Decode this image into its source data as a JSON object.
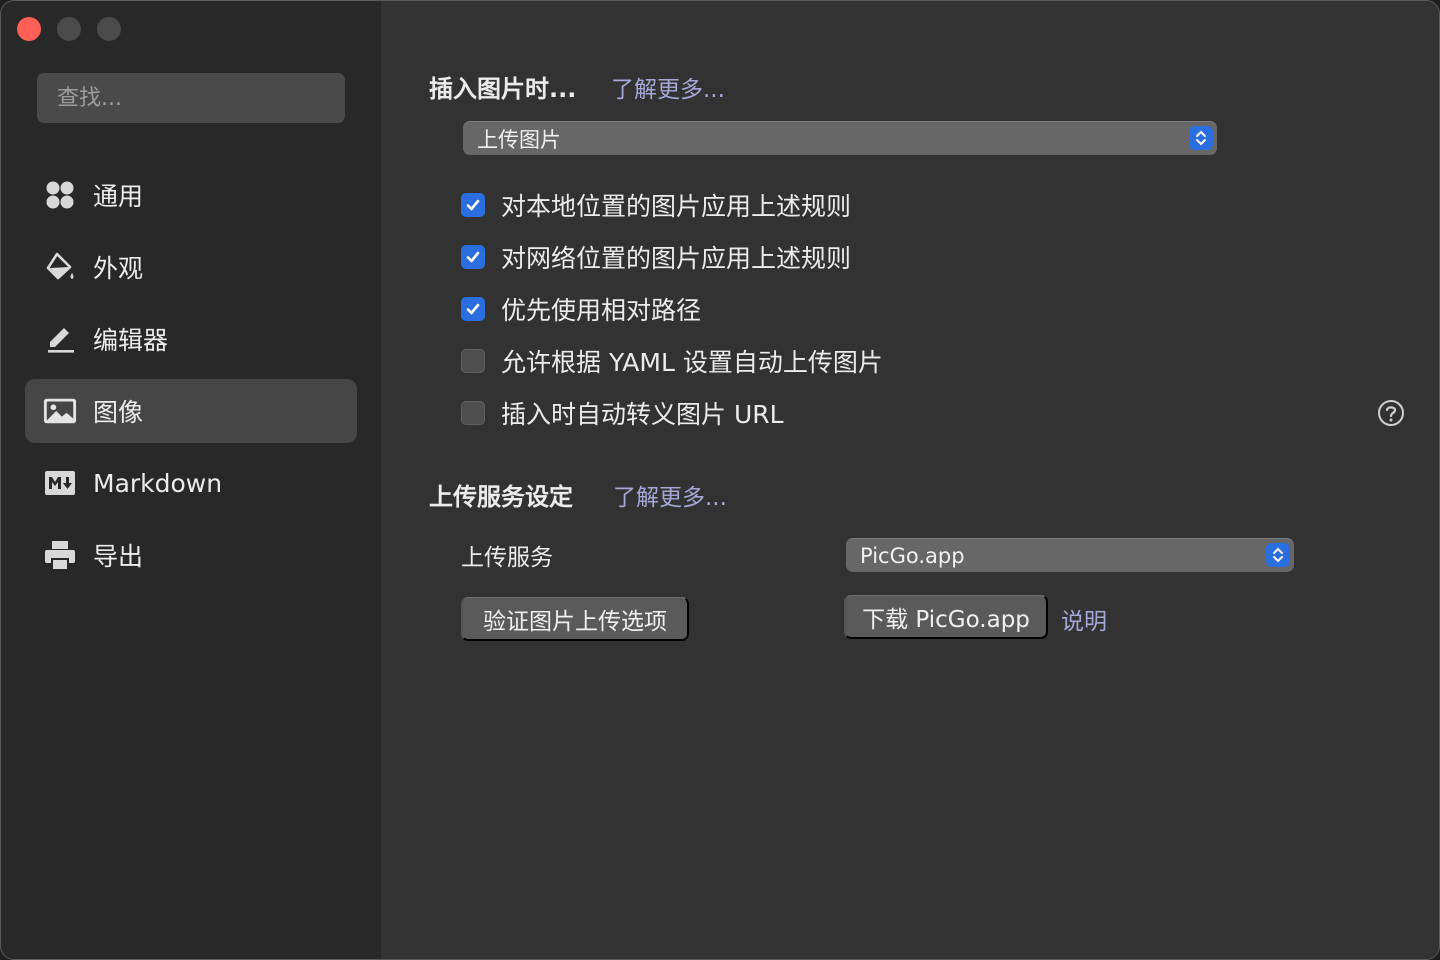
{
  "search": {
    "placeholder": "查找..."
  },
  "sidebar": {
    "items": [
      {
        "label": "通用",
        "icon": "grid-icon",
        "active": false
      },
      {
        "label": "外观",
        "icon": "paint-bucket-icon",
        "active": false
      },
      {
        "label": "编辑器",
        "icon": "pencil-icon",
        "active": false
      },
      {
        "label": "图像",
        "icon": "image-icon",
        "active": true
      },
      {
        "label": "Markdown",
        "icon": "markdown-icon",
        "active": false
      },
      {
        "label": "导出",
        "icon": "printer-icon",
        "active": false
      }
    ]
  },
  "insert_section": {
    "title": "插入图片时...",
    "learn_more": "了解更多...",
    "action_select": "上传图片",
    "options": [
      {
        "label": "对本地位置的图片应用上述规则",
        "checked": true
      },
      {
        "label": "对网络位置的图片应用上述规则",
        "checked": true
      },
      {
        "label": "优先使用相对路径",
        "checked": true
      },
      {
        "label": "允许根据 YAML 设置自动上传图片",
        "checked": false
      },
      {
        "label": "插入时自动转义图片 URL",
        "checked": false
      }
    ]
  },
  "upload_section": {
    "title": "上传服务设定",
    "learn_more": "了解更多...",
    "service_label": "上传服务",
    "service_select": "PicGo.app",
    "verify_button": "验证图片上传选项",
    "download_button": "下载 PicGo.app",
    "help_link": "说明"
  },
  "colors": {
    "accent": "#2a6ee0",
    "link": "#a5a8d6",
    "close": "#fe5f57"
  }
}
